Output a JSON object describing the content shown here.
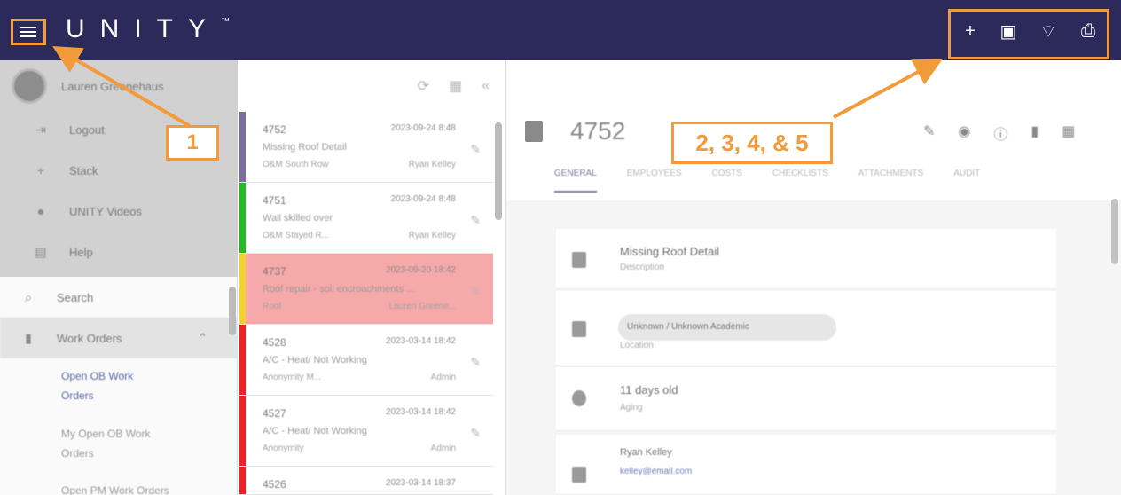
{
  "app": {
    "logo_text": "UNITY",
    "trademark": "™",
    "brand_color": "#2c2a5a",
    "callout_color": "#f39a3b"
  },
  "header": {
    "menu_icon": "hamburger-icon",
    "actions": [
      {
        "icon": "plus-icon",
        "glyph": "+"
      },
      {
        "icon": "calendar-icon",
        "glyph": "▣"
      },
      {
        "icon": "wifi-icon",
        "glyph": "⌔"
      },
      {
        "icon": "print-icon",
        "glyph": "⎙"
      }
    ]
  },
  "callouts": {
    "one": "1",
    "two_to_five": "2, 3, 4, & 5"
  },
  "sidebar": {
    "user_name": "Lauren Greenehaus",
    "menu_items": [
      {
        "label": "Logout",
        "icon": "logout-icon",
        "glyph": "⇥"
      },
      {
        "label": "Stack",
        "icon": "plus-icon",
        "glyph": "+"
      },
      {
        "label": "UNITY Videos",
        "icon": "video-icon",
        "glyph": "●"
      },
      {
        "label": "Help",
        "icon": "help-icon",
        "glyph": "▤"
      }
    ],
    "nav": {
      "search": {
        "label": "Search",
        "icon": "search-icon",
        "glyph": "⌕"
      },
      "work_orders": {
        "label": "Work Orders",
        "icon": "clipboard-icon",
        "glyph": "▮",
        "chevron": "⌃"
      },
      "sub_items": [
        "Open OB Work",
        "Orders",
        "My Open OB Work",
        "Orders",
        "Open PM Work Orders"
      ]
    }
  },
  "list": {
    "tools": [
      "⟳",
      "▦",
      "«"
    ],
    "items": [
      {
        "number": "4752",
        "date": "2023-09-24 8:48",
        "description": "Missing Roof Detail",
        "location": "O&M South Row",
        "assignee": "Ryan Kelley",
        "status_color": "#7a6fa0"
      },
      {
        "number": "4751",
        "date": "2023-09-24 8:48",
        "description": "Wall skilled over",
        "location": "O&M Stayed R...",
        "assignee": "Ryan Kelley",
        "status_color": "#22bb22"
      },
      {
        "number": "4737",
        "date": "2023-09-20 18:42",
        "description": "Roof repair - soil encroachments ...",
        "location": "Roof",
        "assignee": "Lauren Greene...",
        "status_color": "#f2d22f"
      },
      {
        "number": "4528",
        "date": "2023-03-14 18:42",
        "description": "A/C - Heat/ Not Working",
        "location": "Anonymity M...",
        "assignee": "Admin",
        "status_color": "#ee2222"
      },
      {
        "number": "4527",
        "date": "2023-03-14 18:42",
        "description": "A/C - Heat/ Not Working",
        "location": "Anonymity",
        "assignee": "Admin",
        "status_color": "#ee2222"
      },
      {
        "number": "4526",
        "date": "2023-03-14 18:37",
        "description": "",
        "location": "",
        "assignee": "",
        "status_color": "#ee2222"
      }
    ]
  },
  "detail": {
    "number": "4752",
    "tabs": [
      "GENERAL",
      "EMPLOYEES",
      "COSTS",
      "CHECKLISTS",
      "ATTACHMENTS",
      "AUDIT"
    ],
    "fields": [
      {
        "value": "Missing Roof Detail",
        "label": "Description"
      },
      {
        "chip": "Unknown / Unknown Academic",
        "label": "Location"
      },
      {
        "value": "11 days old",
        "label": "Aging"
      },
      {
        "value": "Ryan Kelley",
        "label": "kelley@email.com"
      }
    ]
  }
}
